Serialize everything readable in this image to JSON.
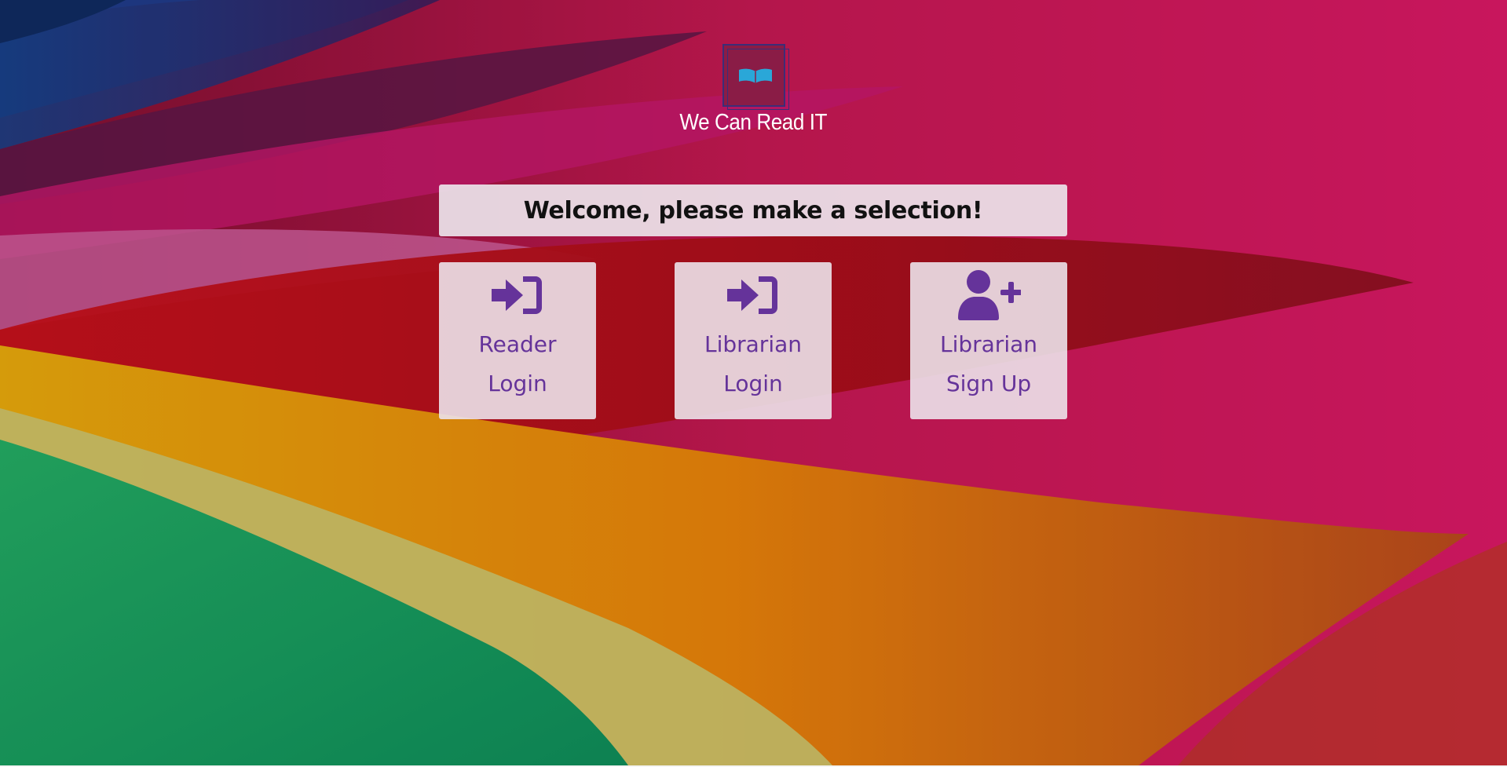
{
  "brand": {
    "name": "We Can Read IT",
    "logo_icon": "open-book-icon",
    "logo_color": "#2aa7d8"
  },
  "welcome": {
    "message": "Welcome, please make a selection!"
  },
  "options": [
    {
      "icon": "sign-in-icon",
      "line1": "Reader",
      "line2": "Login"
    },
    {
      "icon": "sign-in-icon",
      "line1": "Librarian",
      "line2": "Login"
    },
    {
      "icon": "user-plus-icon",
      "line1": "Librarian",
      "line2": "Sign Up"
    }
  ],
  "colors": {
    "accent": "#65339a",
    "card_background": "#ece2ea",
    "welcome_text": "#111111"
  }
}
